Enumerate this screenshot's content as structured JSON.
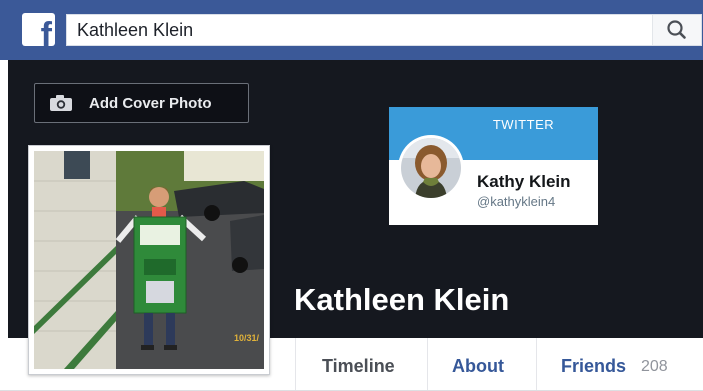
{
  "topbar": {
    "logo_letter": "f",
    "search": {
      "value": "Kathleen Klein"
    },
    "search_button_icon": "search-icon"
  },
  "cover": {
    "add_cover_label": "Add Cover Photo",
    "camera_icon": "camera-icon"
  },
  "twitter_card": {
    "title": "TWITTER",
    "name": "Kathy Klein",
    "handle": "@kathyklein4",
    "header_color": "#3a9bd9"
  },
  "profile": {
    "name": "Kathleen Klein",
    "photo_date_stamp": "10/31/"
  },
  "tabs": [
    {
      "label": "Timeline",
      "active": true
    },
    {
      "label": "About"
    },
    {
      "label": "Friends",
      "count": "208"
    }
  ],
  "colors": {
    "facebook_blue": "#3b5998",
    "link_blue": "#365899",
    "cover_dark": "#15181f"
  }
}
